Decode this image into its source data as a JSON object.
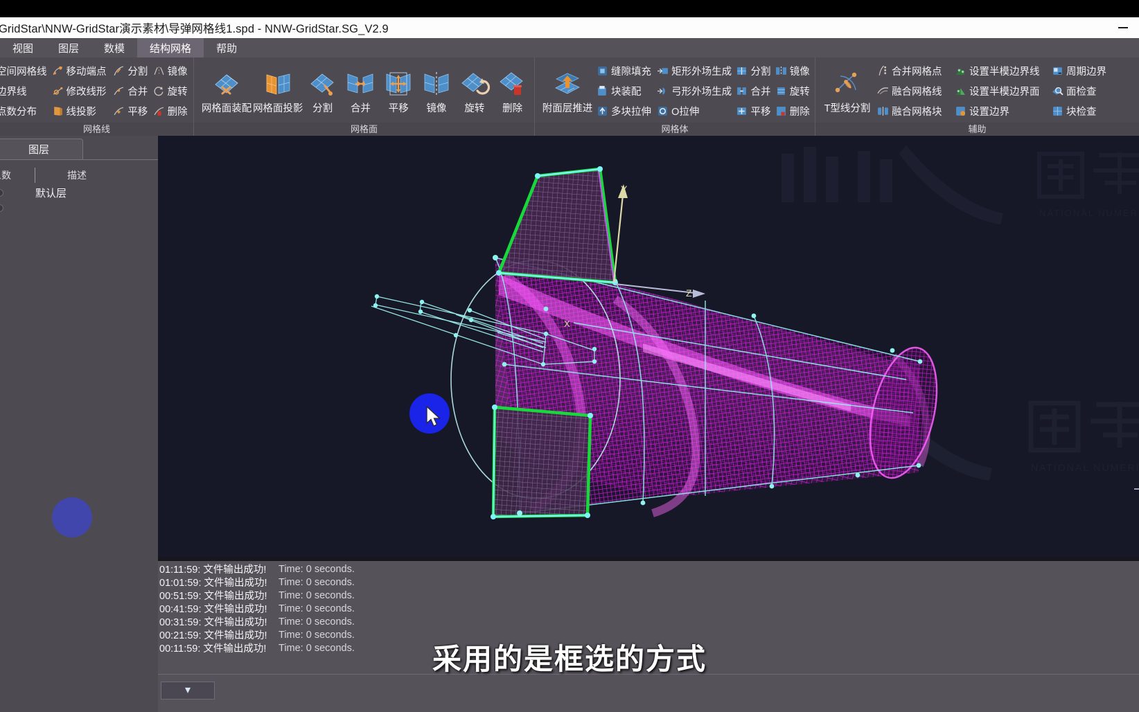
{
  "window": {
    "title": "GridStar\\NNW-GridStar演示素材\\导弹网格线1.spd - NNW-GridStar.SG_V2.9",
    "minimize_label": "—"
  },
  "menubar": {
    "items": [
      {
        "label": "视图",
        "active": false
      },
      {
        "label": "图层",
        "active": false
      },
      {
        "label": "数模",
        "active": false
      },
      {
        "label": "结构网格",
        "active": true
      },
      {
        "label": "帮助",
        "active": false
      }
    ]
  },
  "ribbon": {
    "groups": [
      {
        "name": "网格线",
        "label": "网格线",
        "columns": [
          {
            "type": "text3",
            "items": [
              {
                "label": "空间网格线",
                "icon": "none"
              },
              {
                "label": "边界线",
                "icon": "none"
              },
              {
                "label": "点数分布",
                "icon": "none"
              }
            ]
          },
          {
            "type": "text3",
            "items": [
              {
                "label": "移动端点",
                "icon": "move-endpoint-icon"
              },
              {
                "label": "修改线形",
                "icon": "edit-curve-icon"
              },
              {
                "label": "线投影",
                "icon": "line-project-icon"
              }
            ]
          },
          {
            "type": "text3",
            "items": [
              {
                "label": "分割",
                "icon": "split-icon"
              },
              {
                "label": "合并",
                "icon": "merge-icon"
              },
              {
                "label": "平移",
                "icon": "translate-icon"
              }
            ]
          },
          {
            "type": "text3",
            "items": [
              {
                "label": "镜像",
                "icon": "mirror-icon"
              },
              {
                "label": "旋转",
                "icon": "rotate-icon"
              },
              {
                "label": "删除",
                "icon": "delete-icon"
              }
            ]
          }
        ]
      },
      {
        "name": "网格面",
        "label": "网格面",
        "buttons": [
          {
            "label": "网格面装配",
            "icon": "mesh-face-assemble-icon",
            "wide": true
          },
          {
            "label": "网格面投影",
            "icon": "mesh-face-project-icon",
            "wide": true
          },
          {
            "label": "分割",
            "icon": "mesh-face-split-icon",
            "wide": false
          },
          {
            "label": "合并",
            "icon": "mesh-face-merge-icon",
            "wide": false
          },
          {
            "label": "平移",
            "icon": "mesh-face-translate-icon",
            "wide": false
          },
          {
            "label": "镜像",
            "icon": "mesh-face-mirror-icon",
            "wide": false
          },
          {
            "label": "旋转",
            "icon": "mesh-face-rotate-icon",
            "wide": false
          },
          {
            "label": "删除",
            "icon": "mesh-face-delete-icon",
            "wide": false
          }
        ]
      },
      {
        "name": "网格体",
        "label": "网格体",
        "big": {
          "label": "附面层推进",
          "icon": "boundary-layer-advance-icon"
        },
        "columns": [
          {
            "type": "text3",
            "items": [
              {
                "label": "缝隙填充",
                "icon": "gap-fill-icon"
              },
              {
                "label": "块装配",
                "icon": "block-assemble-icon"
              },
              {
                "label": "多块拉伸",
                "icon": "multiblock-extrude-icon"
              }
            ]
          },
          {
            "type": "text3",
            "items": [
              {
                "label": "矩形外场生成",
                "icon": "rect-farfield-icon"
              },
              {
                "label": "弓形外场生成",
                "icon": "arc-farfield-icon"
              },
              {
                "label": "O拉伸",
                "icon": "o-extrude-icon"
              }
            ]
          },
          {
            "type": "text3",
            "items": [
              {
                "label": "分割",
                "icon": "block-split-icon"
              },
              {
                "label": "合并",
                "icon": "block-merge-icon"
              },
              {
                "label": "平移",
                "icon": "block-translate-icon"
              }
            ]
          },
          {
            "type": "text3",
            "items": [
              {
                "label": "镜像",
                "icon": "block-mirror-icon"
              },
              {
                "label": "旋转",
                "icon": "block-rotate-icon"
              },
              {
                "label": "删除",
                "icon": "block-delete-icon"
              }
            ]
          }
        ]
      },
      {
        "name": "辅助",
        "label": "辅助",
        "big": {
          "label": "T型线分割",
          "icon": "t-line-split-icon"
        },
        "columns": [
          {
            "type": "text3",
            "items": [
              {
                "label": "合并网格点",
                "icon": "merge-points-icon"
              },
              {
                "label": "融合网格线",
                "icon": "blend-lines-icon"
              },
              {
                "label": "融合网格块",
                "icon": "blend-blocks-icon"
              }
            ]
          },
          {
            "type": "text3",
            "items": [
              {
                "label": "设置半模边界线",
                "icon": "half-model-edge-line-icon"
              },
              {
                "label": "设置半模边界面",
                "icon": "half-model-edge-face-icon"
              },
              {
                "label": "设置边界",
                "icon": "set-boundary-icon"
              }
            ]
          },
          {
            "type": "text3",
            "items": [
              {
                "label": "周期边界",
                "icon": "periodic-boundary-icon"
              },
              {
                "label": "面检查",
                "icon": "face-check-icon"
              },
              {
                "label": "块检查",
                "icon": "block-check-icon"
              }
            ]
          }
        ]
      }
    ]
  },
  "left_panel": {
    "tab_label": "图层",
    "columns": [
      "象数",
      "描述"
    ],
    "rows": [
      {
        "name": "默认层"
      }
    ]
  },
  "viewport": {
    "axes": [
      {
        "label": "Y"
      },
      {
        "label": "Z"
      },
      {
        "label": "X"
      }
    ],
    "model_name": "导弹网格线1",
    "colors": {
      "background": "#161827",
      "mesh_magenta": "#e21ce8",
      "mesh_cyan": "#7cf6f2",
      "selected_green": "#17d93a",
      "axis_yellow": "#ddd9a6",
      "cursor_highlight": "#1a24e8"
    }
  },
  "log": {
    "lines": [
      {
        "time": "01:11:59: 文件输出成功!",
        "detail": "Time: 0 seconds."
      },
      {
        "time": "01:01:59: 文件输出成功!",
        "detail": "Time: 0 seconds."
      },
      {
        "time": "00:51:59: 文件输出成功!",
        "detail": "Time: 0 seconds."
      },
      {
        "time": "00:41:59: 文件输出成功!",
        "detail": "Time: 0 seconds."
      },
      {
        "time": "00:31:59: 文件输出成功!",
        "detail": "Time: 0 seconds."
      },
      {
        "time": "00:21:59: 文件输出成功!",
        "detail": "Time: 0 seconds."
      },
      {
        "time": "00:11:59: 文件输出成功!",
        "detail": "Time: 0 seconds."
      }
    ],
    "collapse_icon": "chevron-down-icon"
  },
  "subtitle": {
    "text": "采用的是框选的方式"
  },
  "watermark": {
    "text": "国家数值风洞",
    "subtext": "NATIONAL NUMERICAL WINDTUNNEL"
  }
}
